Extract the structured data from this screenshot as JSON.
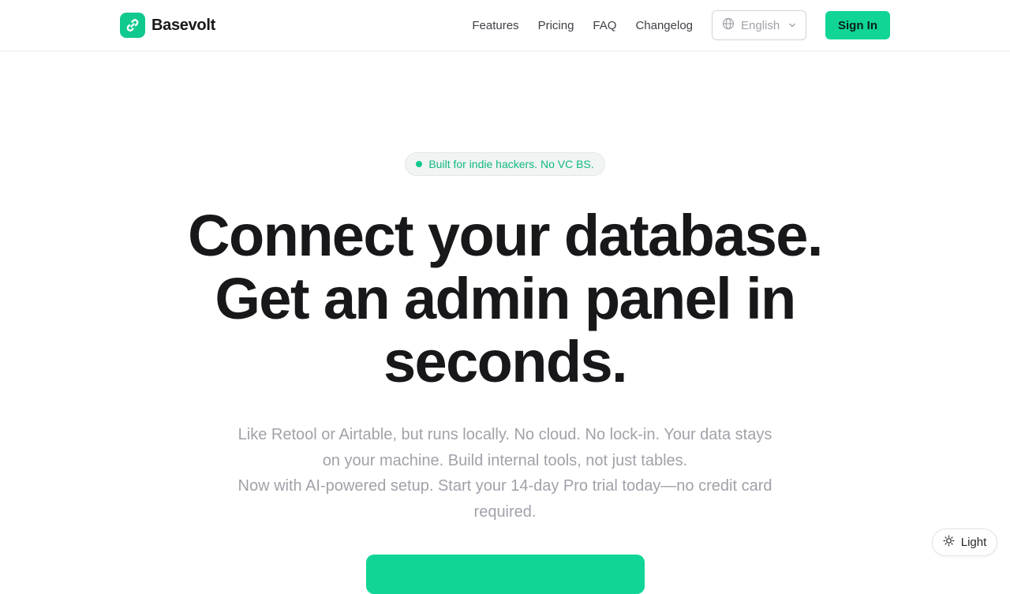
{
  "header": {
    "brand": "Basevolt",
    "nav": [
      "Features",
      "Pricing",
      "FAQ",
      "Changelog"
    ],
    "language": "English",
    "signin_label": "Sign In"
  },
  "hero": {
    "badge": "Built for indie hackers. No VC BS.",
    "headline": "Connect your database. Get an admin panel in seconds.",
    "subtitle_1": "Like Retool or Airtable, but runs locally. No cloud. No lock-in. Your data stays on your machine. Build internal tools, not just tables.",
    "subtitle_2": "Now with AI-powered setup. Start your 14-day Pro trial today—no credit card required."
  },
  "cta": {
    "label": ""
  },
  "theme_toggle": {
    "label": "Light"
  },
  "colors": {
    "accent": "#10d596",
    "badge_text": "#10b981",
    "text": "#18181b",
    "muted": "#a1a1aa"
  },
  "icons": {
    "logo": "link-chain-icon",
    "language": "globe-icon",
    "language_caret": "chevron-down-icon",
    "theme": "sun-icon"
  }
}
